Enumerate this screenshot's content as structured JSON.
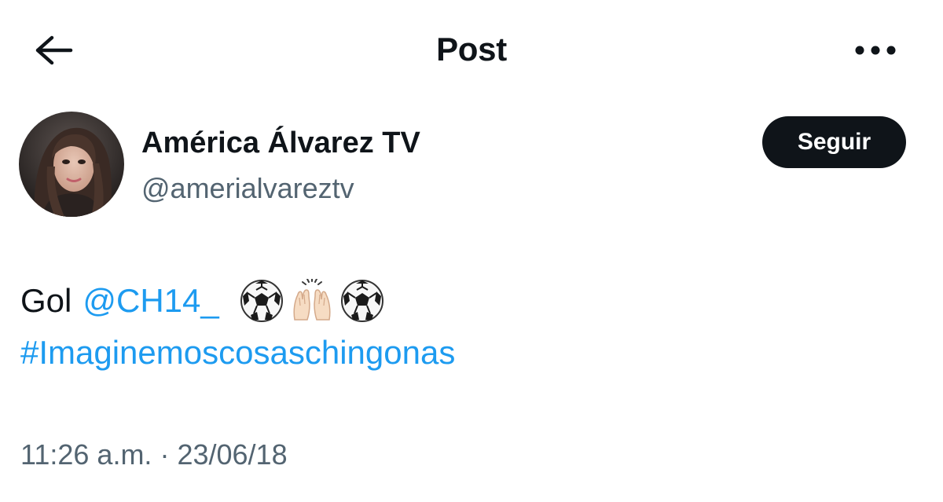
{
  "header": {
    "back_icon": "arrow-left-icon",
    "title": "Post",
    "more_icon": "more-horizontal-icon"
  },
  "author": {
    "display_name": "América Álvarez TV",
    "handle": "@amerialvareztv",
    "follow_label": "Seguir"
  },
  "post": {
    "word": "Gol",
    "mention": "@CH14_",
    "emojis": [
      "soccer-ball-icon",
      "raised-hands-icon",
      "soccer-ball-icon"
    ],
    "hashtag": "#Imaginemoscosaschingonas"
  },
  "meta": {
    "time": "11:26 a.m.",
    "separator": "·",
    "date": "23/06/18"
  },
  "colors": {
    "link": "#1d9bf0",
    "text": "#0f1419",
    "secondary": "#536471",
    "button_bg": "#0f1419"
  }
}
